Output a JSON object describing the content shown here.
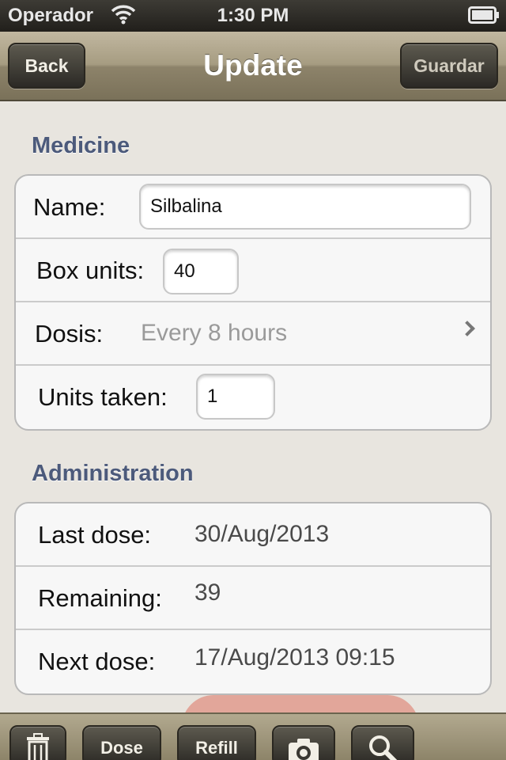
{
  "status": {
    "carrier": "Operador",
    "time": "1:30 PM",
    "icons": [
      "wifi-icon",
      "battery-icon"
    ]
  },
  "nav": {
    "back_label": "Back",
    "title": "Update",
    "save_label": "Guardar"
  },
  "medicine": {
    "header": "Medicine",
    "name_label": "Name:",
    "name_value": "Silbalina",
    "box_units_label": "Box units:",
    "box_units_value": "40",
    "dosis_label": "Dosis:",
    "dosis_value": "Every 8 hours",
    "units_taken_label": "Units taken:",
    "units_taken_value": "1"
  },
  "administration": {
    "header": "Administration",
    "last_dose_label": "Last dose:",
    "last_dose_value": "30/Aug/2013",
    "remaining_label": "Remaining:",
    "remaining_value": "39",
    "next_dose_label": "Next dose:",
    "next_dose_value": "17/Aug/2013 09:15"
  },
  "toolbar": {
    "delete_icon": "trash-icon",
    "dose_label": "Dose",
    "refill_label": "Refill",
    "camera_icon": "camera-icon",
    "search_icon": "search-icon"
  },
  "colors": {
    "section_header": "#4c5a7b",
    "nav_bar": "#a69c81",
    "button_dark": "#2b2925"
  }
}
